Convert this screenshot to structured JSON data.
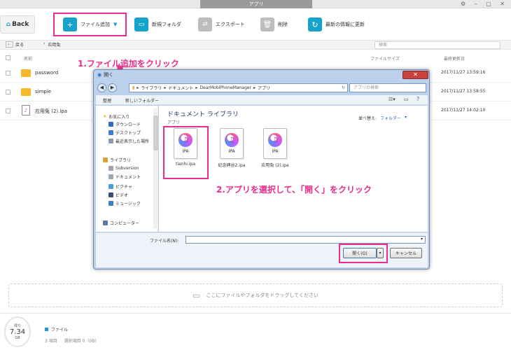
{
  "window": {
    "title": "アプリ"
  },
  "toolbar": {
    "back": "Back",
    "add_file": "ファイル追加",
    "new_folder": "新規フォルダ",
    "export": "エクスポート",
    "delete": "削除",
    "refresh": "最新の情報に更新"
  },
  "nav": {
    "back": "戻る",
    "path": "应用兔",
    "search_placeholder": "検索"
  },
  "columns": {
    "name": "名前",
    "size": "ファイルサイズ",
    "date": "最終更新日"
  },
  "files": [
    {
      "name": "password",
      "date": "2017/11/27 13:59:16",
      "icon": "folder-icon"
    },
    {
      "name": "simple",
      "date": "2017/11/27 13:58:55",
      "icon": "folder-icon"
    },
    {
      "name": "应用兔 (2).ipa",
      "date": "2017/11/27 14:02:10",
      "icon": "ipa-file-icon"
    }
  ],
  "annotations": {
    "step1": "1.ファイル追加をクリック",
    "step2": "2.アプリを選択して、「開く」をクリック"
  },
  "dialog": {
    "title": "開く",
    "breadcrumb": [
      "ライブラリ",
      "ドキュメント",
      "DearMobiPhoneManager",
      "アプリ"
    ],
    "search_placeholder": "アプリの検索",
    "organize": "整理",
    "new_folder": "新しいフォルダー",
    "library_title": "ドキュメント ライブラリ",
    "library_sub": "アプリ",
    "arrange_label": "並べ替え:",
    "arrange_value": "フォルダー",
    "nav_items": [
      "お気に入り",
      "ダウンロード",
      "デスクトップ",
      "最近表示した場所",
      "ライブラリ",
      "Subversion",
      "ドキュメント",
      "ピクチャ",
      "ビデオ",
      "ミュージック",
      "コンピューター"
    ],
    "files": [
      {
        "type": "IPA",
        "name": "tianhi.ipa"
      },
      {
        "type": "IPA",
        "name": "纪念碑谷2.ipa"
      },
      {
        "type": "IPA",
        "name": "应用兔 (2).ipa"
      }
    ],
    "filename_label": "ファイル名(N):",
    "open_button": "開く(O)",
    "cancel_button": "キャンセル"
  },
  "dropzone": {
    "text": "ここにファイルやフォルダをドラッグしてください"
  },
  "footer": {
    "storage_label": "残り",
    "storage_value": "7.34",
    "storage_unit": "GB",
    "category": "ファイル",
    "items": "3 項目",
    "selected": "選択項目 0（0B）"
  },
  "colors": {
    "highlight": "#ea2d8c",
    "accent": "#1a9bd7"
  }
}
